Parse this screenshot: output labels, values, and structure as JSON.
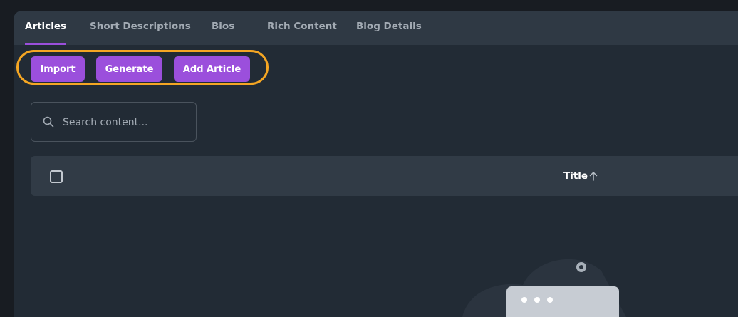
{
  "tabs": [
    {
      "label": "Articles",
      "active": true
    },
    {
      "label": "Short Descriptions",
      "active": false
    },
    {
      "label": "Bios",
      "active": false
    },
    {
      "label": "Rich Content",
      "active": false
    },
    {
      "label": "Blog Details",
      "active": false
    }
  ],
  "toolbar": {
    "import_label": "Import",
    "generate_label": "Generate",
    "add_label": "Add Article"
  },
  "search": {
    "placeholder": "Search content...",
    "value": ""
  },
  "table": {
    "columns": [
      {
        "label": "Title",
        "sort": "ascending"
      }
    ]
  },
  "colors": {
    "accent": "#9b4fdc",
    "highlight": "#f5a623",
    "panel": "#222b35",
    "tabbar": "#2f3944"
  },
  "icons": [
    "search-icon",
    "sort-ascending-icon",
    "empty-state-illustration"
  ]
}
